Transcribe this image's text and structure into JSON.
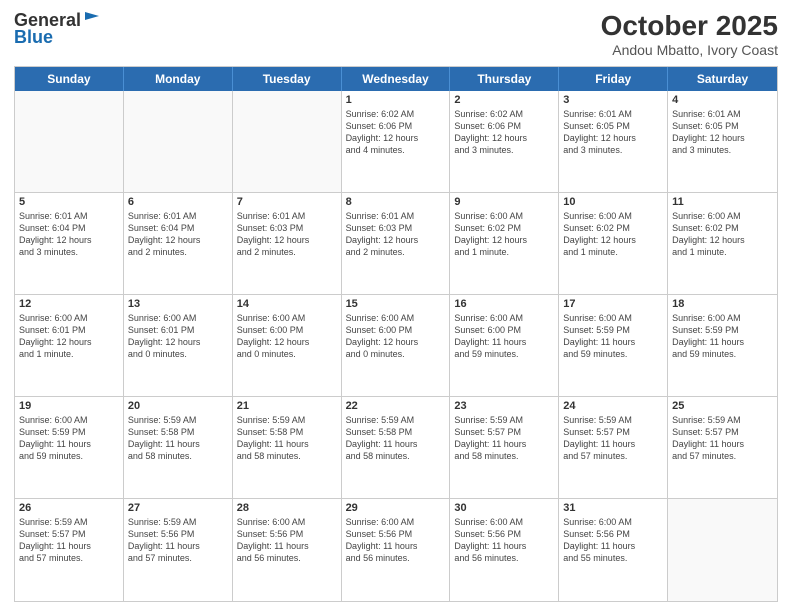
{
  "header": {
    "logo_line1": "General",
    "logo_line2": "Blue",
    "month": "October 2025",
    "location": "Andou Mbatto, Ivory Coast"
  },
  "weekdays": [
    "Sunday",
    "Monday",
    "Tuesday",
    "Wednesday",
    "Thursday",
    "Friday",
    "Saturday"
  ],
  "weeks": [
    [
      {
        "day": "",
        "info": ""
      },
      {
        "day": "",
        "info": ""
      },
      {
        "day": "",
        "info": ""
      },
      {
        "day": "1",
        "info": "Sunrise: 6:02 AM\nSunset: 6:06 PM\nDaylight: 12 hours\nand 4 minutes."
      },
      {
        "day": "2",
        "info": "Sunrise: 6:02 AM\nSunset: 6:06 PM\nDaylight: 12 hours\nand 3 minutes."
      },
      {
        "day": "3",
        "info": "Sunrise: 6:01 AM\nSunset: 6:05 PM\nDaylight: 12 hours\nand 3 minutes."
      },
      {
        "day": "4",
        "info": "Sunrise: 6:01 AM\nSunset: 6:05 PM\nDaylight: 12 hours\nand 3 minutes."
      }
    ],
    [
      {
        "day": "5",
        "info": "Sunrise: 6:01 AM\nSunset: 6:04 PM\nDaylight: 12 hours\nand 3 minutes."
      },
      {
        "day": "6",
        "info": "Sunrise: 6:01 AM\nSunset: 6:04 PM\nDaylight: 12 hours\nand 2 minutes."
      },
      {
        "day": "7",
        "info": "Sunrise: 6:01 AM\nSunset: 6:03 PM\nDaylight: 12 hours\nand 2 minutes."
      },
      {
        "day": "8",
        "info": "Sunrise: 6:01 AM\nSunset: 6:03 PM\nDaylight: 12 hours\nand 2 minutes."
      },
      {
        "day": "9",
        "info": "Sunrise: 6:00 AM\nSunset: 6:02 PM\nDaylight: 12 hours\nand 1 minute."
      },
      {
        "day": "10",
        "info": "Sunrise: 6:00 AM\nSunset: 6:02 PM\nDaylight: 12 hours\nand 1 minute."
      },
      {
        "day": "11",
        "info": "Sunrise: 6:00 AM\nSunset: 6:02 PM\nDaylight: 12 hours\nand 1 minute."
      }
    ],
    [
      {
        "day": "12",
        "info": "Sunrise: 6:00 AM\nSunset: 6:01 PM\nDaylight: 12 hours\nand 1 minute."
      },
      {
        "day": "13",
        "info": "Sunrise: 6:00 AM\nSunset: 6:01 PM\nDaylight: 12 hours\nand 0 minutes."
      },
      {
        "day": "14",
        "info": "Sunrise: 6:00 AM\nSunset: 6:00 PM\nDaylight: 12 hours\nand 0 minutes."
      },
      {
        "day": "15",
        "info": "Sunrise: 6:00 AM\nSunset: 6:00 PM\nDaylight: 12 hours\nand 0 minutes."
      },
      {
        "day": "16",
        "info": "Sunrise: 6:00 AM\nSunset: 6:00 PM\nDaylight: 11 hours\nand 59 minutes."
      },
      {
        "day": "17",
        "info": "Sunrise: 6:00 AM\nSunset: 5:59 PM\nDaylight: 11 hours\nand 59 minutes."
      },
      {
        "day": "18",
        "info": "Sunrise: 6:00 AM\nSunset: 5:59 PM\nDaylight: 11 hours\nand 59 minutes."
      }
    ],
    [
      {
        "day": "19",
        "info": "Sunrise: 6:00 AM\nSunset: 5:59 PM\nDaylight: 11 hours\nand 59 minutes."
      },
      {
        "day": "20",
        "info": "Sunrise: 5:59 AM\nSunset: 5:58 PM\nDaylight: 11 hours\nand 58 minutes."
      },
      {
        "day": "21",
        "info": "Sunrise: 5:59 AM\nSunset: 5:58 PM\nDaylight: 11 hours\nand 58 minutes."
      },
      {
        "day": "22",
        "info": "Sunrise: 5:59 AM\nSunset: 5:58 PM\nDaylight: 11 hours\nand 58 minutes."
      },
      {
        "day": "23",
        "info": "Sunrise: 5:59 AM\nSunset: 5:57 PM\nDaylight: 11 hours\nand 58 minutes."
      },
      {
        "day": "24",
        "info": "Sunrise: 5:59 AM\nSunset: 5:57 PM\nDaylight: 11 hours\nand 57 minutes."
      },
      {
        "day": "25",
        "info": "Sunrise: 5:59 AM\nSunset: 5:57 PM\nDaylight: 11 hours\nand 57 minutes."
      }
    ],
    [
      {
        "day": "26",
        "info": "Sunrise: 5:59 AM\nSunset: 5:57 PM\nDaylight: 11 hours\nand 57 minutes."
      },
      {
        "day": "27",
        "info": "Sunrise: 5:59 AM\nSunset: 5:56 PM\nDaylight: 11 hours\nand 57 minutes."
      },
      {
        "day": "28",
        "info": "Sunrise: 6:00 AM\nSunset: 5:56 PM\nDaylight: 11 hours\nand 56 minutes."
      },
      {
        "day": "29",
        "info": "Sunrise: 6:00 AM\nSunset: 5:56 PM\nDaylight: 11 hours\nand 56 minutes."
      },
      {
        "day": "30",
        "info": "Sunrise: 6:00 AM\nSunset: 5:56 PM\nDaylight: 11 hours\nand 56 minutes."
      },
      {
        "day": "31",
        "info": "Sunrise: 6:00 AM\nSunset: 5:56 PM\nDaylight: 11 hours\nand 55 minutes."
      },
      {
        "day": "",
        "info": ""
      }
    ]
  ]
}
